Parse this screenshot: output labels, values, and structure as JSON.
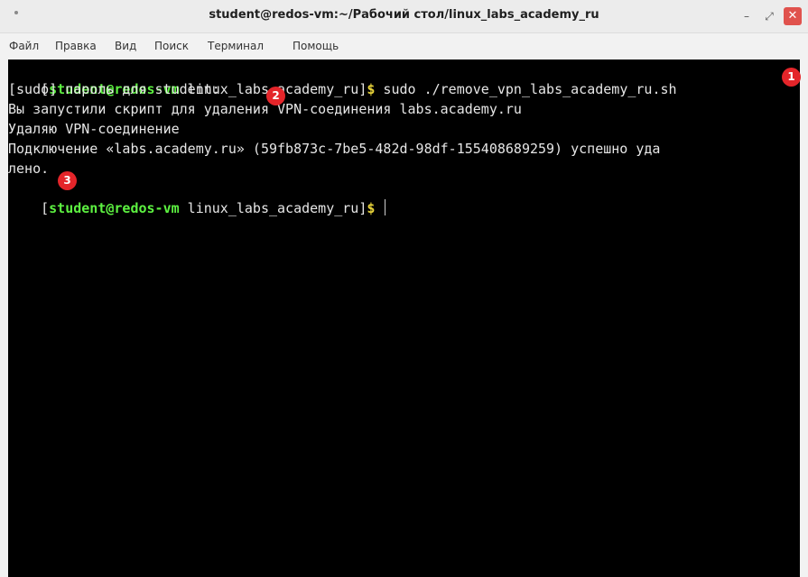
{
  "window": {
    "title": "student@redos-vm:~/Рабочий стол/linux_labs_academy_ru",
    "minimize_glyph": "–",
    "maximize_glyph": "⤢",
    "close_glyph": "✕"
  },
  "menu": [
    "Файл",
    "Правка",
    "Вид",
    "Поиск",
    "Терминал",
    "Помощь"
  ],
  "prompt": {
    "open_bracket": "[",
    "user_host": "student@redos-vm",
    "dir": " linux_labs_academy_ru]",
    "symbol": "$"
  },
  "lines": {
    "command": " sudo ./remove_vpn_labs_academy_ru.sh",
    "sudo_prompt": "[sudo] пароль для student:",
    "msg_started": "Вы запустили скрипт для удаления VPN-соединения labs.academy.ru",
    "msg_removing": "Удаляю VPN-соединение",
    "msg_success_1": "Подключение «labs.academy.ru» (59fb873c-7be5-482d-98df-155408689259) успешно уда",
    "msg_success_2": "лено."
  },
  "markers": [
    "1",
    "2",
    "3"
  ],
  "colors": {
    "terminal_bg": "#000000",
    "prompt_user": "#5df241",
    "prompt_symbol": "#e9d43a",
    "marker": "#e4252a",
    "close_button": "#e0524d"
  }
}
